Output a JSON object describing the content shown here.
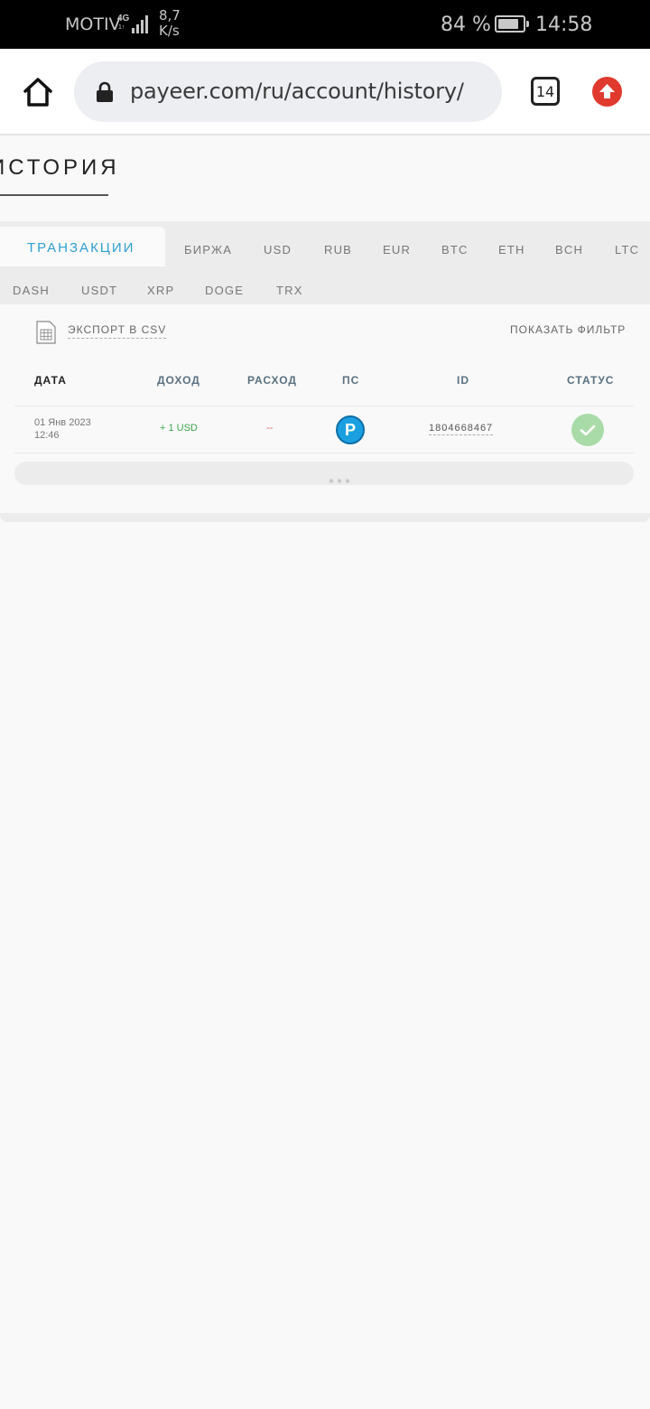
{
  "status_bar": {
    "carrier": "MOTIV",
    "network": "4G",
    "network_sub": "1↑",
    "speed_value": "8,7",
    "speed_unit": "K/s",
    "battery_percent": "84 %",
    "battery_level": 0.84,
    "time": "14:58"
  },
  "browser": {
    "url": "payeer.com/ru/account/history/",
    "tab_count": "14",
    "icons": {
      "home": "home-icon",
      "lock": "lock-icon",
      "update": "arrow-up-icon"
    },
    "accent_color": "#e0392e"
  },
  "page": {
    "title": "ИСТОРИЯ",
    "tabs_row1": [
      "ТРАНЗАКЦИИ",
      "БИРЖА",
      "USD",
      "RUB",
      "EUR",
      "BTC",
      "ETH",
      "BCH",
      "LTC"
    ],
    "tabs_row2": [
      "DASH",
      "USDT",
      "XRP",
      "DOGE",
      "TRX"
    ],
    "active_tab": "ТРАНЗАКЦИИ",
    "export_label": "ЭКСПОРТ В CSV",
    "filter_label": "ПОКАЗАТЬ ФИЛЬТР"
  },
  "table": {
    "headers": [
      "ДАТА",
      "ДОХОД",
      "РАСХОД",
      "ПС",
      "ID",
      "СТАТУС"
    ],
    "rows": [
      {
        "date": "01 Янв 2023",
        "time": "12:46",
        "income": "+ 1 USD",
        "expense": "--",
        "ps": "P",
        "id": "1804668467",
        "status": "success"
      }
    ]
  }
}
